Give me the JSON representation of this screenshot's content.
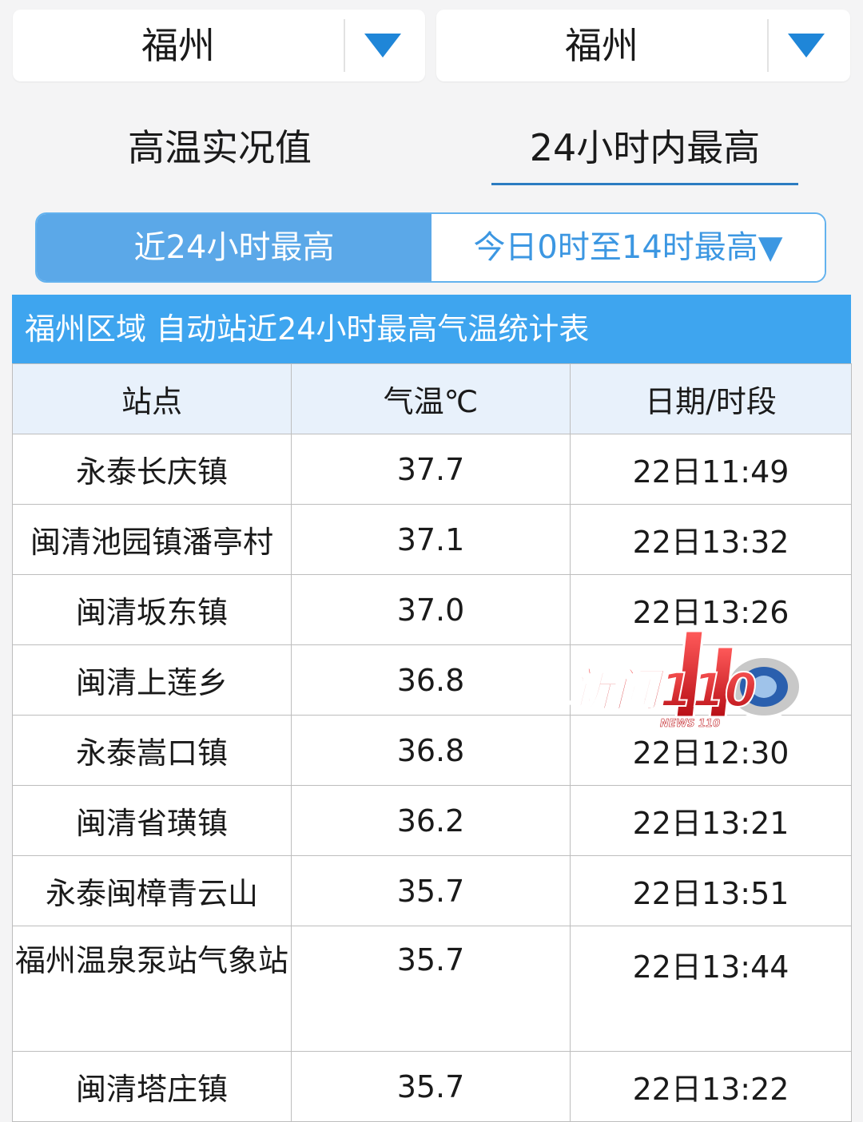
{
  "selects": {
    "left": {
      "value": "福州"
    },
    "right": {
      "value": "福州"
    }
  },
  "main_tabs": [
    {
      "label": "高温实况值"
    },
    {
      "label": "24小时内最高"
    }
  ],
  "sub_tabs": [
    {
      "label": "近24小时最高"
    },
    {
      "label": "今日0时至14时最高▼"
    }
  ],
  "table": {
    "title": "福州区域 自动站近24小时最高气温统计表",
    "headers": [
      "站点",
      "气温℃",
      "日期/时段"
    ],
    "rows": [
      {
        "station": "永泰长庆镇",
        "temp": "37.7",
        "time": "22日11:49"
      },
      {
        "station": "闽清池园镇潘亭村",
        "temp": "37.1",
        "time": "22日13:32"
      },
      {
        "station": "闽清坂东镇",
        "temp": "37.0",
        "time": "22日13:26"
      },
      {
        "station": "闽清上莲乡",
        "temp": "36.8",
        "time": ""
      },
      {
        "station": "永泰嵩口镇",
        "temp": "36.8",
        "time": "22日12:30"
      },
      {
        "station": "闽清省璜镇",
        "temp": "36.2",
        "time": "22日13:21"
      },
      {
        "station": "永泰闽樟青云山",
        "temp": "35.7",
        "time": "22日13:51"
      },
      {
        "station": "福州温泉泵站气象站",
        "temp": "35.7",
        "time": "22日13:44"
      },
      {
        "station": "闽清塔庄镇",
        "temp": "35.7",
        "time": "22日13:22"
      }
    ]
  },
  "watermark": {
    "text": "新闻110",
    "subtext": "NEWS 110"
  },
  "colors": {
    "accent_blue": "#3ea5ef",
    "active_tab": "#5ba8e8",
    "arrow_blue": "#1f86d8",
    "watermark_red": "#e3262c"
  }
}
